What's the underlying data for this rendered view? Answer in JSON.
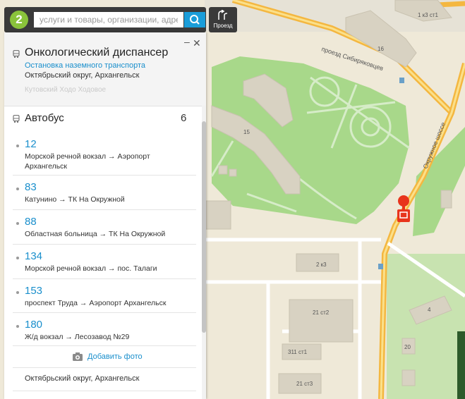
{
  "search": {
    "logo": "2",
    "placeholder": "услуги и товары, организации, адреса",
    "value": ""
  },
  "route_button": {
    "label": "Проезд"
  },
  "place": {
    "title": "Онкологический диспансер",
    "type_link": "Остановка наземного транспорта",
    "district": "Октябрьский округ, Архангельск",
    "ghost_text": "Кутовский Ходо  Ходовое"
  },
  "transport": {
    "section_title": "Автобус",
    "count": "6",
    "routes": [
      {
        "number": "12",
        "description": "Морской речной вокзал → Аэропорт Архангельск"
      },
      {
        "number": "83",
        "description": "Катунино → ТК На Окружной"
      },
      {
        "number": "88",
        "description": "Областная больница → ТК На Окружной"
      },
      {
        "number": "134",
        "description": "Морской речной вокзал → пос. Талаги"
      },
      {
        "number": "153",
        "description": "проспект Труда → Аэропорт Архангельск"
      },
      {
        "number": "180",
        "description": "Ж/д вокзал → Лесозавод №29"
      }
    ]
  },
  "add_photo": "Добавить фото",
  "footer_address": "Октябрьский округ, Архангельск",
  "map": {
    "street_labels": [
      "проезд Сибиряковцев",
      "Окружное шоссе"
    ],
    "building_labels": [
      "1 к3 ст1",
      "16",
      "15",
      "2 к3",
      "21 ст2",
      "311 ст1",
      "21 ст3",
      "4",
      "20"
    ],
    "colors": {
      "road": "#f4b740",
      "park": "#a8d88a",
      "building": "#d8d2c2",
      "marker": "#e8341c",
      "accent": "#1a9dd9"
    }
  }
}
